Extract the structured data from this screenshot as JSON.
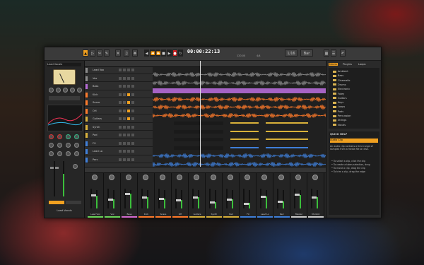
{
  "toolbar": {
    "time": "00:00:22:13",
    "tempo": "120.00",
    "meter": "4/4",
    "labels": [
      "Select",
      "Move",
      "Edit",
      "Snap",
      "Loop",
      "Record"
    ]
  },
  "browser": {
    "tabs": [
      "Media",
      "Plugins",
      "Loops"
    ],
    "folders": [
      "Ambient",
      "Bass",
      "Cinematic",
      "Drums",
      "Electronic",
      "Foley",
      "Guitars",
      "Keys",
      "Loops",
      "Pads",
      "Percussion",
      "Strings",
      "Vocals"
    ],
    "info_title": "QUICK HELP",
    "info_heading": "Audio Clip",
    "info_text": "An audio clip contains a time range of samples from a media file on disk.",
    "bullets": [
      "To select a clip, click the clip",
      "To create a takes selection, drag",
      "To move a clip, drag the clip",
      "To trim a clip, drag the edge"
    ]
  },
  "tracks": [
    {
      "name": "Lead Vox",
      "color": "#8b8b8b"
    },
    {
      "name": "Vox",
      "color": "#8b8b8b"
    },
    {
      "name": "Bass",
      "color": "#b56ad6"
    },
    {
      "name": "Kick",
      "color": "#ff7a2a"
    },
    {
      "name": "Snare",
      "color": "#ff7a2a"
    },
    {
      "name": "OH",
      "color": "#ff7a2a"
    },
    {
      "name": "Guitars",
      "color": "#d9b13a"
    },
    {
      "name": "Synth",
      "color": "#d9b13a"
    },
    {
      "name": "Pad",
      "color": "#d9b13a"
    },
    {
      "name": "FX",
      "color": "#3f7fd9"
    },
    {
      "name": "Lead Lo",
      "color": "#3f7fd9"
    },
    {
      "name": "Perc",
      "color": "#3f7fd9"
    }
  ],
  "console": {
    "strips": [
      {
        "name": "Lead Vox",
        "color": "#6bd65a",
        "level": 0.7
      },
      {
        "name": "Vox",
        "color": "#6bd65a",
        "level": 0.5
      },
      {
        "name": "Bass",
        "color": "#d66ad1",
        "level": 0.8
      },
      {
        "name": "Kick",
        "color": "#ff7a2a",
        "level": 0.6
      },
      {
        "name": "Snare",
        "color": "#ff7a2a",
        "level": 0.55
      },
      {
        "name": "OH",
        "color": "#ff7a2a",
        "level": 0.45
      },
      {
        "name": "Guitars",
        "color": "#d9b13a",
        "level": 0.6
      },
      {
        "name": "Synth",
        "color": "#d9b13a",
        "level": 0.35
      },
      {
        "name": "Pad",
        "color": "#d9b13a",
        "level": 0.5
      },
      {
        "name": "FX",
        "color": "#3f7fd9",
        "level": 0.3
      },
      {
        "name": "Lead Lo",
        "color": "#3f7fd9",
        "level": 0.65
      },
      {
        "name": "Perc",
        "color": "#3f7fd9",
        "level": 0.4
      },
      {
        "name": "Master",
        "color": "#cccccc",
        "level": 0.75
      },
      {
        "name": "Monitor",
        "color": "#cccccc",
        "level": 0.6
      }
    ]
  },
  "inspector": {
    "track_name": "Lead Vocals"
  }
}
